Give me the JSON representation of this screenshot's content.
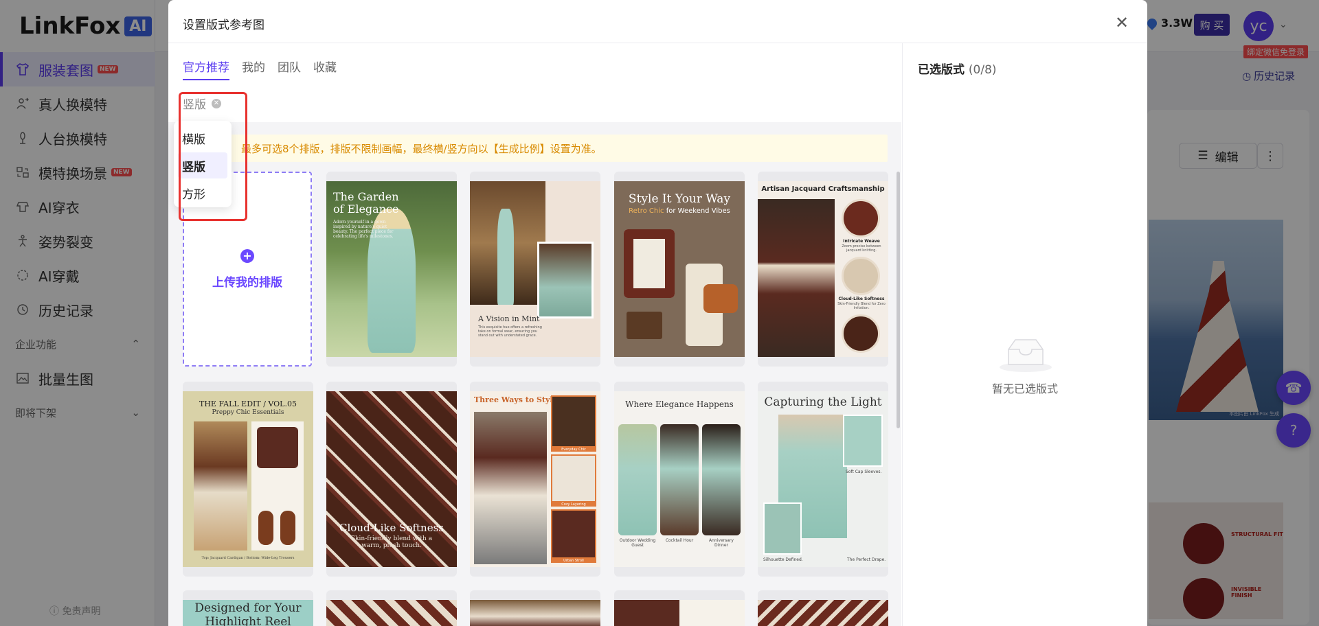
{
  "app": {
    "logo_text": "LinkFox",
    "logo_ai": "AI",
    "nav": [
      {
        "label": "服装套图",
        "icon": "shirt-icon",
        "new": "NEW",
        "active": true
      },
      {
        "label": "真人换模特",
        "icon": "person-swap-icon"
      },
      {
        "label": "人台换模特",
        "icon": "mannequin-icon"
      },
      {
        "label": "模特换场景",
        "icon": "scene-icon",
        "new": "NEW"
      },
      {
        "label": "AI穿衣",
        "icon": "ai-wear-icon"
      },
      {
        "label": "姿势裂变",
        "icon": "pose-icon"
      },
      {
        "label": "AI穿戴",
        "icon": "accessory-icon"
      },
      {
        "label": "历史记录",
        "icon": "history-icon"
      }
    ],
    "section_enterprise": "企业功能",
    "batch_item": "批量生图",
    "section_deprecated": "即将下架",
    "disclaimer": "免责声明",
    "credits": "3.3W",
    "buy": "购 买",
    "avatar": "yc",
    "wechat_tip": "绑定微信免登录",
    "history_link": "历史记录",
    "edit_button": "编辑"
  },
  "modal": {
    "title": "设置版式参考图",
    "tabs": [
      {
        "label": "官方推荐",
        "active": true
      },
      {
        "label": "我的"
      },
      {
        "label": "团队"
      },
      {
        "label": "收藏"
      }
    ],
    "filter_chip": "竖版",
    "dropdown_options": [
      {
        "label": "横版"
      },
      {
        "label": "竖版",
        "selected": true
      },
      {
        "label": "方形"
      }
    ],
    "notice": "最多可选8个排版，排版不限制画幅，最终横/竖方向以【生成比例】设置为准。",
    "upload_label": "上传我的排版",
    "selected_title": "已选版式",
    "selected_count": "(0/8)",
    "empty_text": "暂无已选版式"
  },
  "cards": {
    "c1": {
      "title": "The Garden of Elegance",
      "body": "Adorn yourself in a gown inspired by nature's quiet beauty. The perfect piece for celebrating life's milestones."
    },
    "c2": {
      "title": "A Vision in Mint",
      "body": "This exquisite hue offers a refreshing take on formal wear, ensuring you stand out with understated grace."
    },
    "c3": {
      "title": "Style It Your Way",
      "sub_colored": "Retro Chic",
      "sub_rest": "for Weekend Vibes"
    },
    "c4": {
      "title": "Artisan Jacquard Craftsmanship",
      "lbl1": "Intricate Weave",
      "lbl1b": "Zoom precise between jacquard knitting.",
      "lbl2": "Cloud-Like Softness",
      "lbl2b": "Skin-Friendly Blend for Zero Irritation."
    },
    "c5": {
      "title": "THE FALL EDIT / VOL.05",
      "sub": "Preppy Chic Essentials",
      "foot": "Top: Jacquard Cardigan / Bottom: Wide-Leg Trousers"
    },
    "c6": {
      "title": "Cloud-Like Softness",
      "sub": "Skin-friendly blend with a warm, plush touch."
    },
    "c7": {
      "title": "Three Ways to Style",
      "l1": "Everyday Chic",
      "l2": "Cozy Layering",
      "l3": "Urban Stroll"
    },
    "c8": {
      "title": "Where Elegance Happens",
      "l1": "Outdoor Wedding Guest",
      "l2": "Cocktail Hour",
      "l3": "Anniversary Dinner"
    },
    "c9": {
      "title": "Capturing the Light",
      "l1": "Soft Cap Sleeves.",
      "l2": "Silhouette Defined.",
      "l3": "The Perfect Drape."
    },
    "c10": {
      "title": "Designed for Your Highlight Reel"
    }
  },
  "preview": {
    "label1": "STRUCTURAL FIT",
    "label2": "INVISIBLE FINISH",
    "watermark": "本图片由 LinkFox 生成"
  },
  "colors": {
    "accent": "#5b3df0",
    "notice": "#d88a00",
    "highlight": "#e8322f"
  }
}
